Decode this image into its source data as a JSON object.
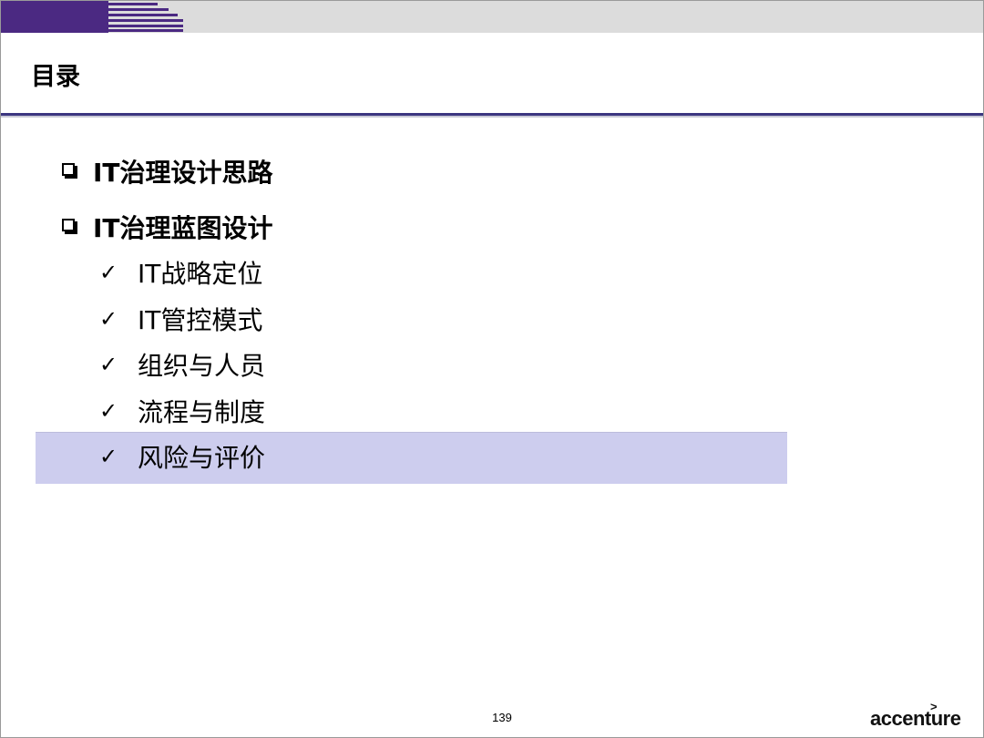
{
  "header": {
    "title": "目录"
  },
  "outline": {
    "sections": [
      {
        "label": "IT治理设计思路"
      },
      {
        "label": "IT治理蓝图设计"
      }
    ],
    "subitems": [
      {
        "label": "IT战略定位",
        "highlighted": false
      },
      {
        "label": "IT管控模式",
        "highlighted": false
      },
      {
        "label": "组织与人员",
        "highlighted": false
      },
      {
        "label": "流程与制度",
        "highlighted": false
      },
      {
        "label": "风险与评价",
        "highlighted": true
      }
    ]
  },
  "icons": {
    "section_bullet": "checkbox-square-icon",
    "subitem_bullet": "checkmark-icon",
    "checkmark_glyph": "✓"
  },
  "footer": {
    "page_number": "139",
    "brand": "accenture",
    "brand_mark": ">"
  },
  "colors": {
    "brand_purple": "#4b2982",
    "title_rule": "#3c3680",
    "highlight": "#cdcdee",
    "top_band": "#dcdcdc"
  }
}
